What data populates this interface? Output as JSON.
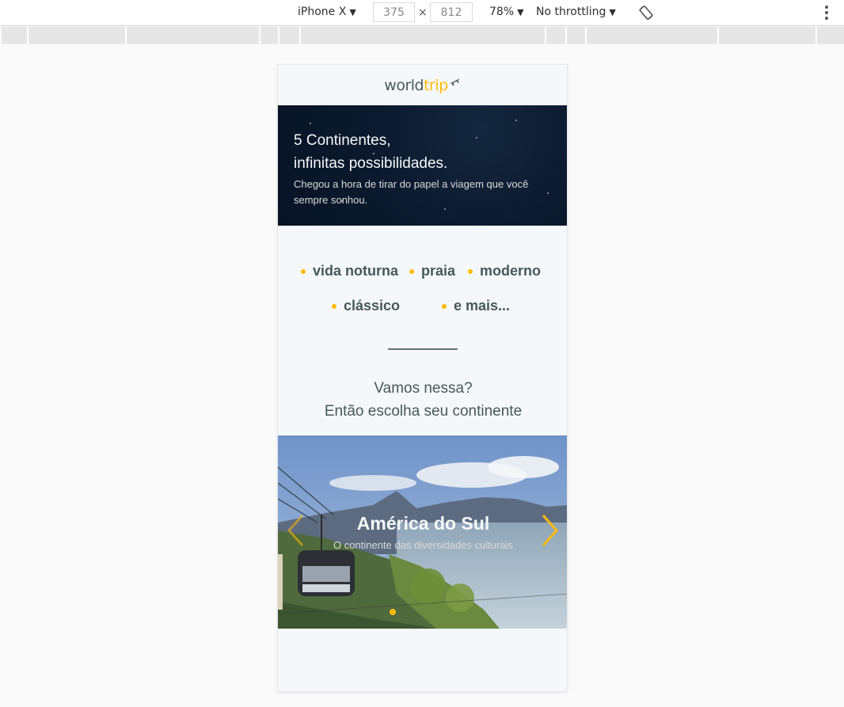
{
  "devtools": {
    "device": "iPhone X",
    "width": "375",
    "height": "812",
    "times": "×",
    "zoom": "78%",
    "throttling": "No throttling",
    "icons": [
      "caret-down-icon",
      "rotate-icon",
      "more-vert-icon"
    ]
  },
  "site": {
    "logo": {
      "word1": "world",
      "word2": "trip",
      "icon": "airplane-icon"
    },
    "hero": {
      "title_line1": "5 Continentes,",
      "title_line2": "infinitas possibilidades.",
      "subtitle": "Chegou a hora de tirar do papel a viagem que você sempre sonhou."
    },
    "travel_types": [
      "vida noturna",
      "praia",
      "moderno",
      "clássico",
      "e mais..."
    ],
    "cta_line1": "Vamos nessa?",
    "cta_line2": "Então escolha seu continente",
    "slider": {
      "active_index": 0,
      "slide_count": 5,
      "slide": {
        "title": "América do Sul",
        "subtitle": "O continente das diversidades culturais"
      },
      "icons": [
        "chevron-left-icon",
        "chevron-right-icon"
      ]
    }
  },
  "colors": {
    "accent": "#ffba08",
    "text_dark": "#47585b",
    "background": "#f5f8fa",
    "hero_dark": "#0b1a2e"
  }
}
